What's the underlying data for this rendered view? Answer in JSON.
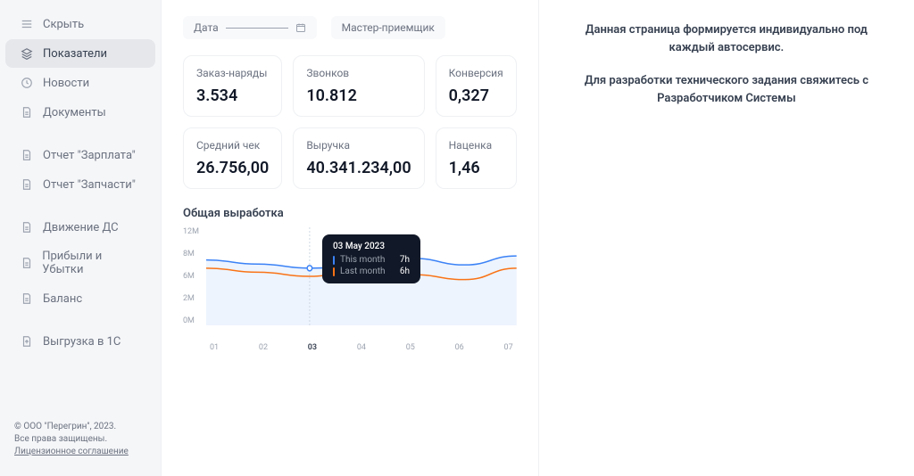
{
  "sidebar": {
    "items": [
      {
        "label": "Скрыть",
        "icon": "menu"
      },
      {
        "label": "Показатели",
        "icon": "layers",
        "active": true
      },
      {
        "label": "Новости",
        "icon": "clock"
      },
      {
        "label": "Документы",
        "icon": "doc"
      },
      {
        "label": "Отчет \"Зарплата\"",
        "icon": "doc"
      },
      {
        "label": "Отчет \"Запчасти\"",
        "icon": "doc"
      },
      {
        "label": "Движение ДС",
        "icon": "doc"
      },
      {
        "label": "Прибыли и Убытки",
        "icon": "doc"
      },
      {
        "label": "Баланс",
        "icon": "doc"
      },
      {
        "label": "Выгрузка в 1С",
        "icon": "upload"
      }
    ],
    "copyright": "© ООО \"Перегрин\", 2023.",
    "rights": "Все права защищены.",
    "license": "Лицензионное соглашение"
  },
  "filters": {
    "date_label": "Дата",
    "master_label": "Мастер-приемщик"
  },
  "cards": [
    {
      "label": "Заказ-наряды",
      "value": "3.534"
    },
    {
      "label": "Звонков",
      "value": "10.812"
    },
    {
      "label": "Конверсия",
      "value": "0,327"
    },
    {
      "label": "Средний чек",
      "value": "26.756,00"
    },
    {
      "label": "Выручка",
      "value": "40.341.234,00"
    },
    {
      "label": "Наценка",
      "value": "1,46"
    }
  ],
  "chart_title": "Общая выработка",
  "chart_data": {
    "type": "line",
    "ylabel": "",
    "xlabel": "",
    "ylim": [
      0,
      12000000
    ],
    "y_ticks": [
      "12M",
      "8M",
      "6M",
      "2M",
      "0M"
    ],
    "categories": [
      "01",
      "02",
      "03",
      "04",
      "05",
      "06",
      "07"
    ],
    "highlight_category": "03",
    "series": [
      {
        "name": "This month",
        "color": "#3b82f6",
        "values": [
          8000000,
          7500000,
          7000000,
          7200000,
          8200000,
          7400000,
          8500000
        ]
      },
      {
        "name": "Last month",
        "color": "#f97316",
        "values": [
          7000000,
          6500000,
          6000000,
          6800000,
          6200000,
          5600000,
          7000000
        ]
      }
    ],
    "tooltip": {
      "date": "03 May 2023",
      "rows": [
        {
          "label": "This month",
          "value": "7h"
        },
        {
          "label": "Last month",
          "value": "6h"
        }
      ]
    }
  },
  "right": {
    "p1": "Данная страница формируется индивидуально под каждый автосервис.",
    "p2": "Для разработки технического задания свяжитесь с Разработчиком Системы"
  }
}
